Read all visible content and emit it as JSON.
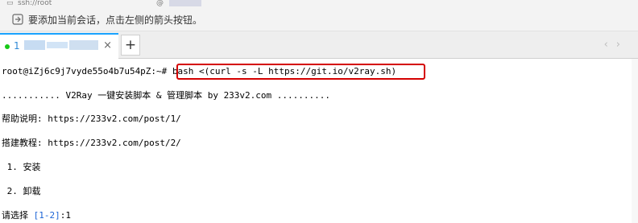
{
  "top_fragment": {
    "left_text": "ssh://root",
    "at_text": "@"
  },
  "hint": {
    "icon": "info-icon",
    "text": "要添加当前会话，点击左侧的箭头按钮。"
  },
  "tabs": [
    {
      "label": "1",
      "status_color": "#17c917",
      "close_label": "×"
    }
  ],
  "tabbar": {
    "add_label": "+",
    "left_arrow": "‹",
    "right_arrow": "›"
  },
  "terminal": {
    "prompt": "root@iZj6c9j7vyde55o4b7u54pZ:~#",
    "command": "bash <(curl -s -L https://git.io/v2ray.sh)",
    "banner": "........... V2Ray 一键安装脚本 & 管理脚本 by 233v2.com ..........",
    "help": "帮助说明: https://233v2.com/post/1/",
    "tutorial": "搭建教程: https://233v2.com/post/2/",
    "options": [
      " 1. 安装",
      " 2. 卸载"
    ],
    "select_prompt": "请选择 ",
    "select_range": "[1-2]",
    "select_suffix": ":1"
  }
}
